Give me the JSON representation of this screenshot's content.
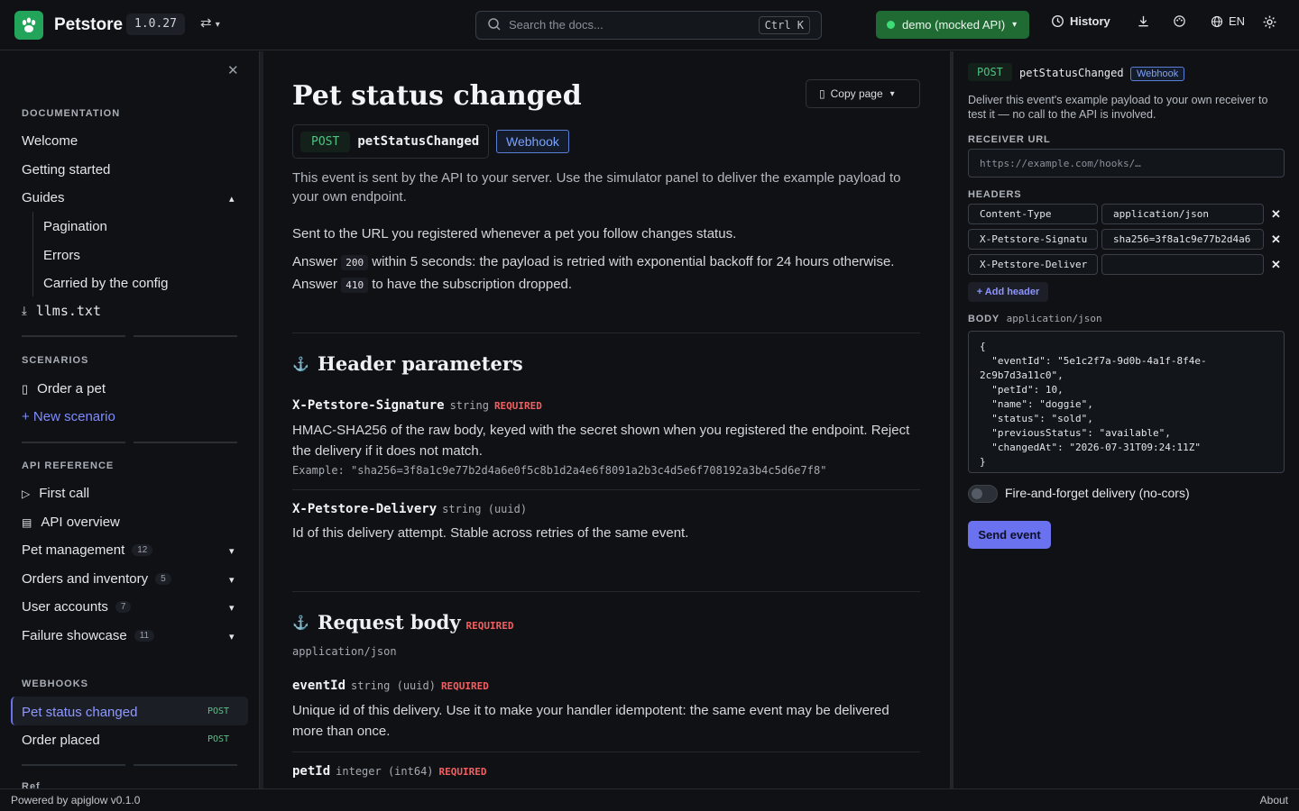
{
  "topbar": {
    "brand": "Petstore",
    "version": "1.0.27",
    "search_placeholder": "Search the docs...",
    "search_shortcut": "Ctrl K",
    "environment": "demo (mocked API)",
    "history_label": "History",
    "language": "EN",
    "colors": {
      "env_bg": "#1f6b33",
      "logo_bg": "#22a55a",
      "accent": "#6b72f0"
    }
  },
  "sidebar": {
    "documentation_heading": "DOCUMENTATION",
    "doc_items": [
      "Welcome",
      "Getting started"
    ],
    "guides_label": "Guides",
    "guide_items": [
      "Pagination",
      "Errors",
      "Carried by the config"
    ],
    "llms_label": "llms.txt",
    "scenarios_heading": "SCENARIOS",
    "scenario_item": "Order a pet",
    "new_scenario": "+ New scenario",
    "api_reference_heading": "API REFERENCE",
    "first_call": "First call",
    "api_overview": "API overview",
    "groups": [
      {
        "label": "Pet management",
        "count": "12"
      },
      {
        "label": "Orders and inventory",
        "count": "5"
      },
      {
        "label": "User accounts",
        "count": "7"
      },
      {
        "label": "Failure showcase",
        "count": "11"
      }
    ],
    "webhooks_heading": "WEBHOOKS",
    "webhooks": [
      {
        "label": "Pet status changed",
        "method": "POST"
      },
      {
        "label": "Order placed",
        "method": "POST"
      }
    ],
    "cut_off_item": "Ref"
  },
  "main": {
    "title": "Pet status changed",
    "copy_page": "Copy page",
    "method": "POST",
    "operation": "petStatusChanged",
    "webhook_badge": "Webhook",
    "intro": "This event is sent by the API to your server. Use the simulator panel to deliver the example payload to your own endpoint.",
    "sent_to": "Sent to the URL you registered whenever a pet you follow changes status.",
    "answer_prefix": "Answer",
    "code_200": "200",
    "answer_200_rest": "within 5 seconds: the payload is retried with exponential backoff for 24 hours otherwise.",
    "code_410": "410",
    "answer_410_rest": "to have the subscription dropped.",
    "header_params_title": "Header parameters",
    "params": [
      {
        "name": "X-Petstore-Signature",
        "type": "string",
        "required": "REQUIRED",
        "desc": "HMAC-SHA256 of the raw body, keyed with the secret shown when you registered the endpoint. Reject the delivery if it does not match.",
        "example": "Example: \"sha256=3f8a1c9e77b2d4a6e0f5c8b1d2a4e6f8091a2b3c4d5e6f708192a3b4c5d6e7f8\""
      },
      {
        "name": "X-Petstore-Delivery",
        "type": "string (uuid)",
        "required": "",
        "desc": "Id of this delivery attempt. Stable across retries of the same event.",
        "example": ""
      }
    ],
    "request_body_title": "Request body",
    "request_body_required": "REQUIRED",
    "content_type": "application/json",
    "body_fields": [
      {
        "name": "eventId",
        "type": "string (uuid)",
        "required": "REQUIRED",
        "desc": "Unique id of this delivery. Use it to make your handler idempotent: the same event may be delivered more than once."
      },
      {
        "name": "petId",
        "type": "integer (int64)",
        "required": "REQUIRED",
        "desc": ""
      }
    ]
  },
  "panel": {
    "method": "POST",
    "operation": "petStatusChanged",
    "webhook_badge": "Webhook",
    "description": "Deliver this event's example payload to your own receiver to test it — no call to the API is involved.",
    "receiver_label": "RECEIVER URL",
    "receiver_placeholder": "https://example.com/hooks/…",
    "headers_label": "HEADERS",
    "headers": [
      {
        "key": "Content-Type",
        "value": "application/json"
      },
      {
        "key": "X-Petstore-Signatu",
        "value": "sha256=3f8a1c9e77b2d4a6"
      },
      {
        "key": "X-Petstore-Deliver",
        "value": ""
      }
    ],
    "add_header": "+ Add header",
    "body_label": "BODY",
    "body_type": "application/json",
    "body_json": "{\n  \"eventId\": \"5e1c2f7a-9d0b-4a1f-8f4e-\n2c9b7d3a11c0\",\n  \"petId\": 10,\n  \"name\": \"doggie\",\n  \"status\": \"sold\",\n  \"previousStatus\": \"available\",\n  \"changedAt\": \"2026-07-31T09:24:11Z\"\n}",
    "fire_forget": "Fire-and-forget delivery (no-cors)",
    "send": "Send event"
  },
  "footer": {
    "powered_by": "Powered by apiglow v0.1.0",
    "about": "About"
  }
}
